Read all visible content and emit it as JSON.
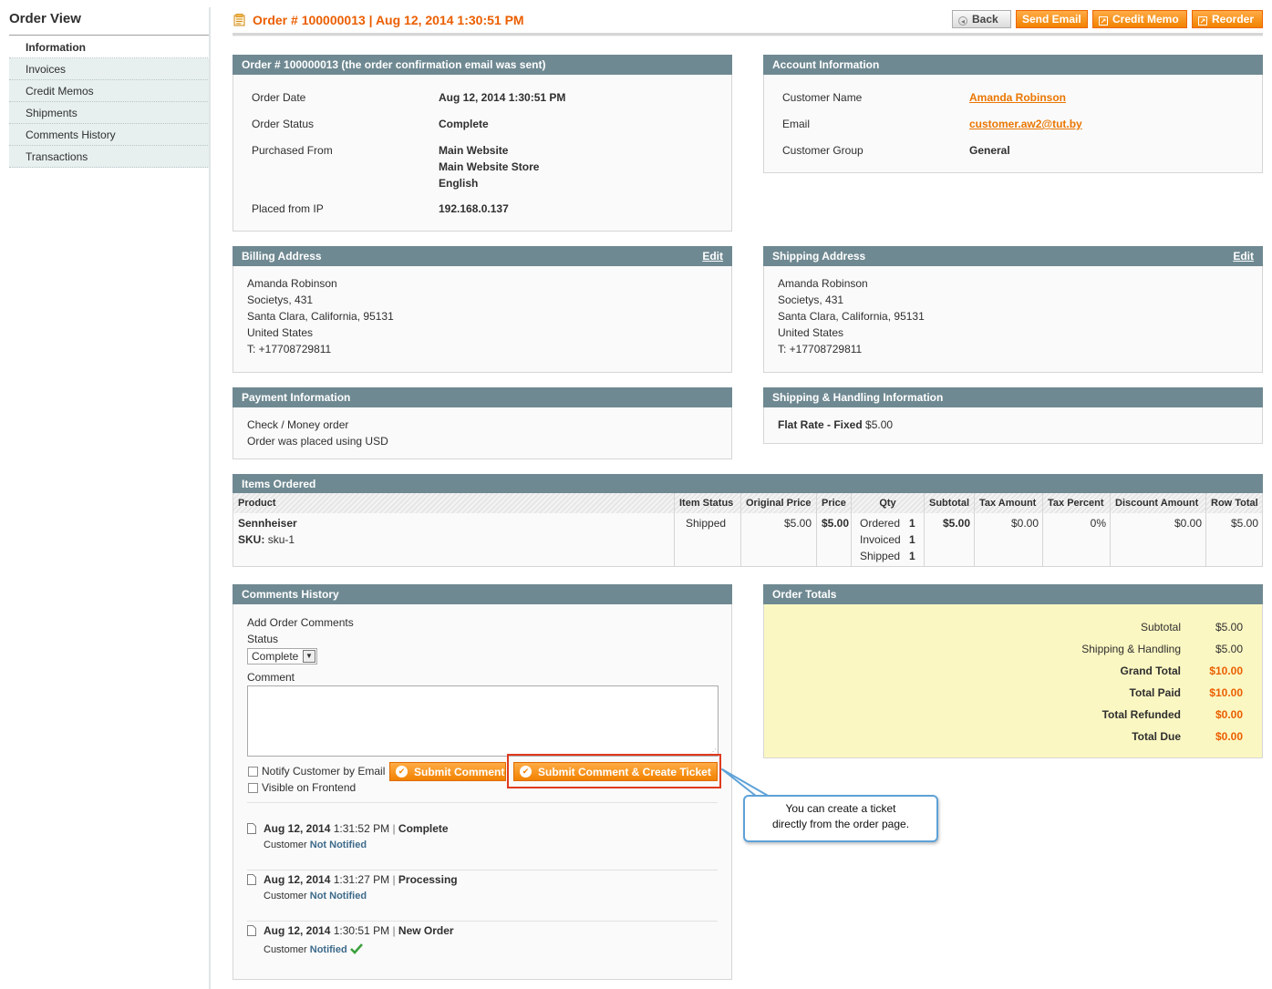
{
  "sidebar": {
    "title": "Order View",
    "tabs": [
      "Information",
      "Invoices",
      "Credit Memos",
      "Shipments",
      "Comments History",
      "Transactions"
    ]
  },
  "header": {
    "title": "Order # 100000013 | Aug 12, 2014 1:30:51 PM",
    "buttons": {
      "back": "Back",
      "send_email": "Send Email",
      "credit_memo": "Credit Memo",
      "reorder": "Reorder"
    }
  },
  "order_info": {
    "heading": "Order # 100000013 (the order confirmation email was sent)",
    "order_date_label": "Order Date",
    "order_date": "Aug 12, 2014 1:30:51 PM",
    "status_label": "Order Status",
    "status": "Complete",
    "purchased_label": "Purchased From",
    "purchased_from": [
      "Main Website",
      "Main Website Store",
      "English"
    ],
    "ip_label": "Placed from IP",
    "ip": "192.168.0.137"
  },
  "account_info": {
    "heading": "Account Information",
    "name_label": "Customer Name",
    "name": "Amanda Robinson",
    "email_label": "Email",
    "email": "customer.aw2@tut.by",
    "group_label": "Customer Group",
    "group": "General"
  },
  "billing": {
    "heading": "Billing Address",
    "edit": "Edit",
    "lines": [
      "Amanda Robinson",
      "Societys, 431",
      "Santa Clara, California, 95131",
      "United States",
      "T: +17708729811"
    ]
  },
  "shipping": {
    "heading": "Shipping Address",
    "edit": "Edit",
    "lines": [
      "Amanda Robinson",
      "Societys, 431",
      "Santa Clara, California, 95131",
      "United States",
      "T: +17708729811"
    ]
  },
  "payment": {
    "heading": "Payment Information",
    "lines": [
      "Check / Money order",
      "Order was placed using USD"
    ]
  },
  "shipping_method": {
    "heading": "Shipping & Handling Information",
    "method": "Flat Rate - Fixed",
    "price": "$5.00"
  },
  "items": {
    "heading": "Items Ordered",
    "columns": [
      "Product",
      "Item Status",
      "Original Price",
      "Price",
      "Qty",
      "Subtotal",
      "Tax Amount",
      "Tax Percent",
      "Discount Amount",
      "Row Total"
    ],
    "row": {
      "product": "Sennheiser",
      "sku_label": "SKU:",
      "sku": "sku-1",
      "status": "Shipped",
      "original_price": "$5.00",
      "price": "$5.00",
      "qty_ordered_label": "Ordered",
      "qty_ordered": "1",
      "qty_invoiced_label": "Invoiced",
      "qty_invoiced": "1",
      "qty_shipped_label": "Shipped",
      "qty_shipped": "1",
      "subtotal": "$5.00",
      "tax_amount": "$0.00",
      "tax_percent": "0%",
      "discount": "$0.00",
      "row_total": "$5.00"
    }
  },
  "comments": {
    "heading": "Comments History",
    "add_label": "Add Order Comments",
    "status_label": "Status",
    "status_value": "Complete",
    "comment_label": "Comment",
    "notify_label": "Notify Customer by Email",
    "visible_label": "Visible on Frontend",
    "submit": "Submit Comment",
    "submit_ticket": "Submit Comment & Create Ticket",
    "history": [
      {
        "date": "Aug 12, 2014",
        "time": "1:31:52 PM",
        "status": "Complete",
        "customer": "Customer",
        "notified": "Not Notified"
      },
      {
        "date": "Aug 12, 2014",
        "time": "1:31:27 PM",
        "status": "Processing",
        "customer": "Customer",
        "notified": "Not Notified"
      },
      {
        "date": "Aug 12, 2014",
        "time": "1:30:51 PM",
        "status": "New Order",
        "customer": "Customer",
        "notified": "Notified"
      }
    ]
  },
  "totals": {
    "heading": "Order Totals",
    "rows": [
      {
        "label": "Subtotal",
        "value": "$5.00"
      },
      {
        "label": "Shipping & Handling",
        "value": "$5.00"
      },
      {
        "label": "Grand Total",
        "value": "$10.00"
      },
      {
        "label": "Total Paid",
        "value": "$10.00"
      },
      {
        "label": "Total Refunded",
        "value": "$0.00"
      },
      {
        "label": "Total Due",
        "value": "$0.00"
      }
    ]
  },
  "callout": {
    "line1": "You can create a ticket",
    "line2": "directly from the order page."
  },
  "colors": {
    "accent": "#eb5e00",
    "panel_header": "#6f8992",
    "totals_bg": "#fbf7c2",
    "highlight_border": "#e03a1e",
    "callout_border": "#5ea2d8"
  }
}
